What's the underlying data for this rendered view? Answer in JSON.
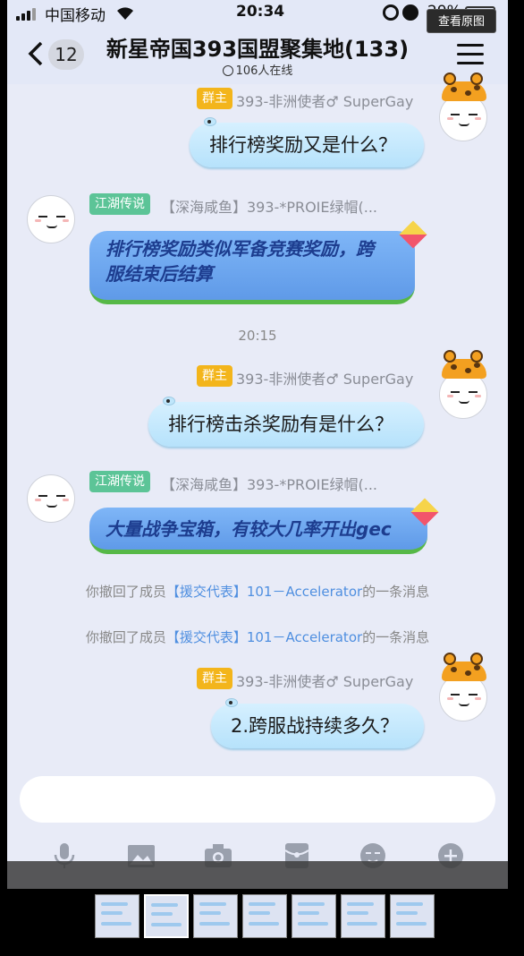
{
  "status_bar": {
    "carrier": "中国移动",
    "time": "20:34",
    "battery": "29%"
  },
  "overlay": {
    "view_original": "查看原图"
  },
  "header": {
    "back_count": "12",
    "title": "新星帝国393国盟聚集地(133)",
    "online": "106人在线"
  },
  "messages": [
    {
      "badge": "群主",
      "sender": "393-非洲使者♂ SuperGay",
      "text": "排行榜奖励又是什么？"
    },
    {
      "badge": "江湖传说",
      "sender": "【深海咸鱼】393-*PROIE绿帽(...",
      "text_line1": "排行榜奖励类似军备竞赛奖励，跨",
      "text_line2": "服结束后结算"
    },
    {
      "time": "20:15"
    },
    {
      "badge": "群主",
      "sender": "393-非洲使者♂ SuperGay",
      "text": "排行榜击杀奖励有是什么？"
    },
    {
      "badge": "江湖传说",
      "sender": "【深海咸鱼】393-*PROIE绿帽(...",
      "text": "大量战争宝箱，有较大几率开出gec"
    },
    {
      "recall_prefix": "你撤回了成员",
      "recall_member": "【援交代表】101－Accelerator",
      "recall_suffix": "的一条消息"
    },
    {
      "recall_prefix": "你撤回了成员",
      "recall_member": "【援交代表】101－Accelerator",
      "recall_suffix": "的一条消息"
    },
    {
      "badge": "群主",
      "sender": "393-非洲使者♂ SuperGay",
      "text": "2.跨服战持续多久？"
    }
  ],
  "toolbar": [
    "microphone-icon",
    "image-icon",
    "camera-icon",
    "red-packet-icon",
    "emoji-icon",
    "plus-icon"
  ],
  "thumbnails": {
    "count": 7,
    "active_index": 1
  }
}
